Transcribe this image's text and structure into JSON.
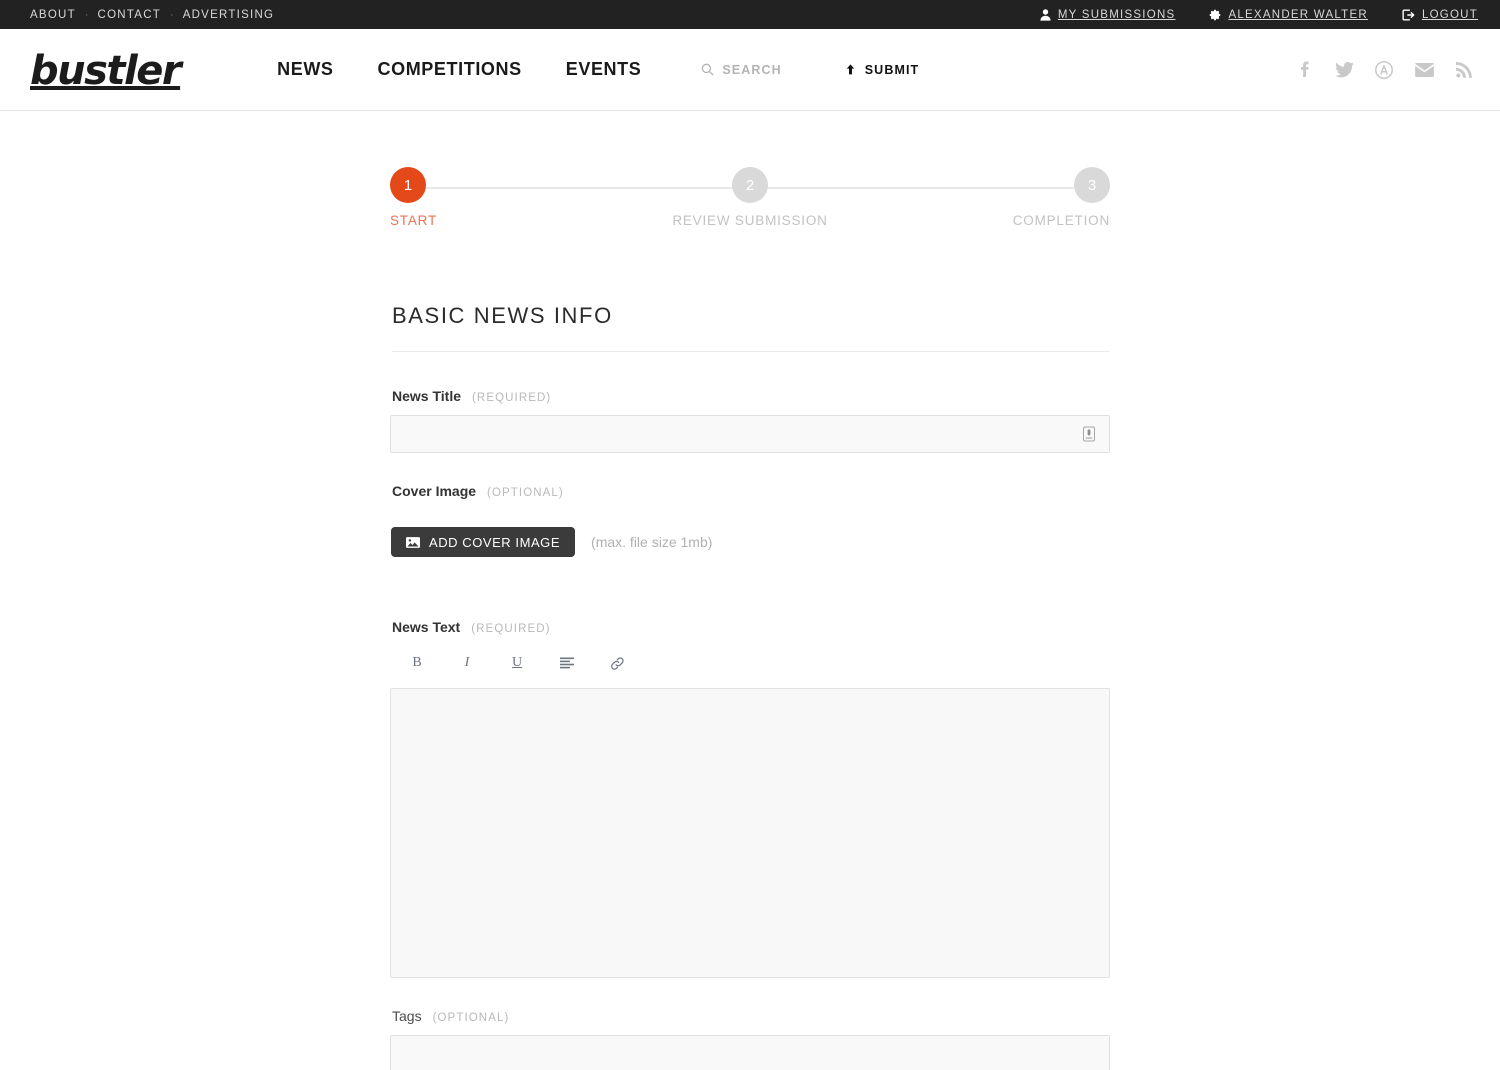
{
  "topbar": {
    "links": [
      {
        "label": "ABOUT"
      },
      {
        "label": "CONTACT"
      },
      {
        "label": "ADVERTISING"
      }
    ],
    "separator": "·",
    "account": [
      {
        "label": "MY SUBMISSIONS",
        "icon": "user-icon"
      },
      {
        "label": "ALEXANDER WALTER",
        "icon": "gear-icon"
      },
      {
        "label": "LOGOUT",
        "icon": "logout-icon"
      }
    ]
  },
  "header": {
    "logo": "bustler",
    "nav": [
      {
        "label": "NEWS"
      },
      {
        "label": "COMPETITIONS"
      },
      {
        "label": "EVENTS"
      }
    ],
    "search_label": "SEARCH",
    "submit_label": "SUBMIT",
    "socials": [
      {
        "name": "facebook-icon"
      },
      {
        "name": "twitter-icon"
      },
      {
        "name": "archinect-icon"
      },
      {
        "name": "email-icon"
      },
      {
        "name": "rss-icon"
      }
    ]
  },
  "stepper": {
    "steps": [
      {
        "number": "1",
        "label": "START",
        "state": "active"
      },
      {
        "number": "2",
        "label": "REVIEW SUBMISSION",
        "state": "inactive"
      },
      {
        "number": "3",
        "label": "COMPLETION",
        "state": "inactive"
      }
    ],
    "active_color": "#e4491a",
    "active_label_color": "#ee7151",
    "inactive_color": "#d9d9d9"
  },
  "form": {
    "section_title": "BASIC NEWS INFO",
    "news_title": {
      "label": "News Title",
      "requirement": "(REQUIRED)",
      "value": "",
      "placeholder": ""
    },
    "cover_image": {
      "label": "Cover Image",
      "requirement": "(OPTIONAL)",
      "button_label": "ADD COVER IMAGE",
      "hint": "(max. file size 1mb)"
    },
    "news_text": {
      "label": "News Text",
      "requirement": "(REQUIRED)",
      "value": "",
      "toolbar": [
        {
          "label": "B",
          "name": "bold-button"
        },
        {
          "label": "I",
          "name": "italic-button"
        },
        {
          "label": "U",
          "name": "underline-button"
        },
        {
          "label": "",
          "name": "list-button"
        },
        {
          "label": "",
          "name": "link-button"
        }
      ]
    },
    "tags": {
      "label": "Tags",
      "requirement": "(OPTIONAL)",
      "value": ""
    }
  }
}
